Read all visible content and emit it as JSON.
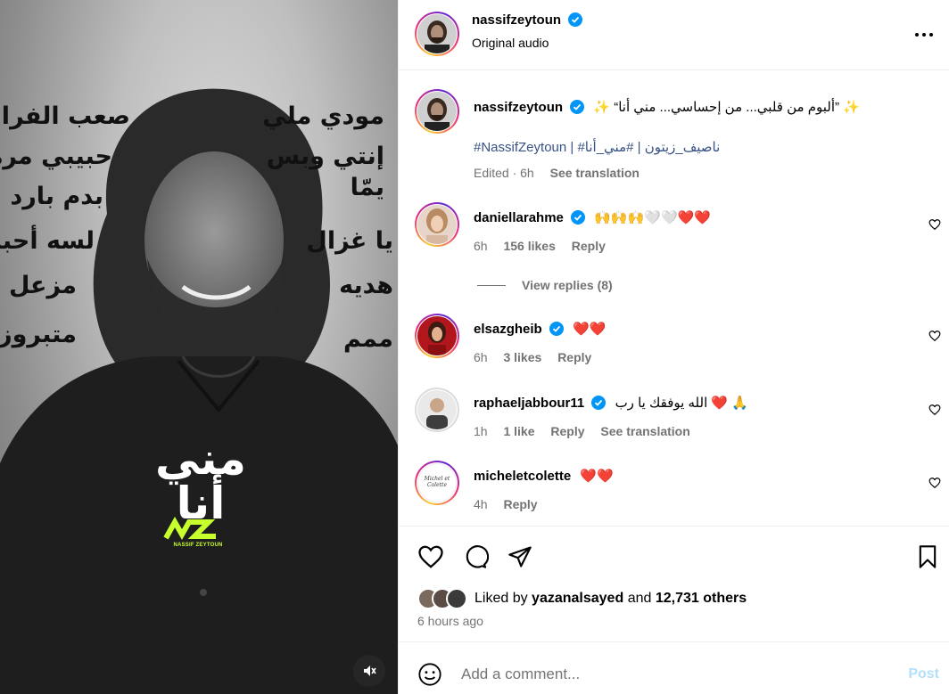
{
  "post": {
    "author": "nassifzeytoun",
    "audio": "Original audio",
    "caption": "✨ “ألبوم من قلبي... من إحساسي... مني أنا” ✨",
    "hashtags": "#NassifZeytoun | #ناصيف_زيتون | #مني_أنا",
    "meta_time": "Edited · 6h",
    "see_translation": "See translation"
  },
  "media": {
    "album_title": "مني أنا",
    "logo_caption": "NASSIF ZEYTOUN",
    "words_left": [
      "صعب الفراق",
      "حبيبي مرة",
      "بدم بارد",
      "لسه أحبك",
      "مزعل",
      "متبروز"
    ],
    "words_right": [
      "مودي ملي",
      "إنتي وبس",
      "يمّا",
      "يا غزال",
      "هديه",
      "ممم"
    ]
  },
  "comments": [
    {
      "user": "daniellarahme",
      "text": "🙌🙌🙌🤍🤍❤️❤️",
      "time": "6h",
      "likes": "156 likes",
      "reply": "Reply",
      "replies": "View replies (8)",
      "verified": true
    },
    {
      "user": "elsazgheib",
      "text": "❤️❤️",
      "time": "6h",
      "likes": "3 likes",
      "reply": "Reply",
      "verified": true
    },
    {
      "user": "raphaeljabbour11",
      "text": "الله يوفقك يا رب ❤️ 🙏",
      "time": "1h",
      "likes": "1 like",
      "reply": "Reply",
      "translation": "See translation",
      "verified": true
    },
    {
      "user": "micheletcolette",
      "text": "❤️❤️",
      "time": "4h",
      "reply": "Reply",
      "verified": false,
      "avatar_text": "Michel et Colette"
    }
  ],
  "likes": {
    "prefix": "Liked by",
    "user": "yazanalsayed",
    "and": "and",
    "others": "12,731 others",
    "time": "6 hours ago"
  },
  "composer": {
    "placeholder": "Add a comment...",
    "post_label": "Post"
  },
  "colors": {
    "verified": "#0095f6",
    "link": "#385185",
    "post_button": "#b2dffc",
    "heart": "#e0142d"
  }
}
